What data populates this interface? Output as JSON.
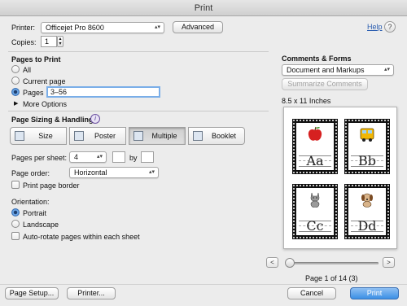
{
  "window": {
    "title": "Print"
  },
  "printer": {
    "label": "Printer:",
    "value": "Officejet Pro 8600",
    "advanced_label": "Advanced",
    "help_label": "Help",
    "help_glyph": "?"
  },
  "copies": {
    "label": "Copies:",
    "value": "1"
  },
  "pages_to_print": {
    "heading": "Pages to Print",
    "options": [
      {
        "label": "All",
        "selected": false
      },
      {
        "label": "Current page",
        "selected": false
      },
      {
        "label": "Pages",
        "selected": true
      }
    ],
    "range_value": "3–56",
    "more_options_label": "More Options"
  },
  "sizing": {
    "heading": "Page Sizing & Handling",
    "info_glyph": "i",
    "modes": [
      {
        "label": "Size",
        "selected": false
      },
      {
        "label": "Poster",
        "selected": false
      },
      {
        "label": "Multiple",
        "selected": true
      },
      {
        "label": "Booklet",
        "selected": false
      }
    ]
  },
  "multiple": {
    "pages_per_sheet_label": "Pages per sheet:",
    "pages_per_sheet_value": "4",
    "by_label": "by",
    "page_order_label": "Page order:",
    "page_order_value": "Horizontal",
    "print_border_label": "Print page border",
    "print_border_checked": false
  },
  "orientation": {
    "heading": "Orientation:",
    "options": [
      {
        "label": "Portrait",
        "selected": true
      },
      {
        "label": "Landscape",
        "selected": false
      }
    ],
    "auto_rotate_label": "Auto-rotate pages within each sheet",
    "auto_rotate_checked": false
  },
  "comments_forms": {
    "heading": "Comments & Forms",
    "value": "Document and Markups",
    "summarize_label": "Summarize Comments"
  },
  "preview": {
    "paper_size": "8.5 x 11 Inches",
    "cards": [
      {
        "letters": "Aa",
        "picture": "apple-icon"
      },
      {
        "letters": "Bb",
        "picture": "school-bus-icon"
      },
      {
        "letters": "Cc",
        "picture": "cat-icon"
      },
      {
        "letters": "Dd",
        "picture": "dog-icon"
      }
    ],
    "prev_glyph": "<",
    "next_glyph": ">",
    "page_info": "Page 1 of 14 (3)",
    "slider_position": 0
  },
  "footer": {
    "page_setup_label": "Page Setup...",
    "printer_label": "Printer...",
    "cancel_label": "Cancel",
    "print_label": "Print"
  },
  "colors": {
    "accent": "#3b8fe5",
    "link": "#2a5db0",
    "card_border": "#111111"
  }
}
